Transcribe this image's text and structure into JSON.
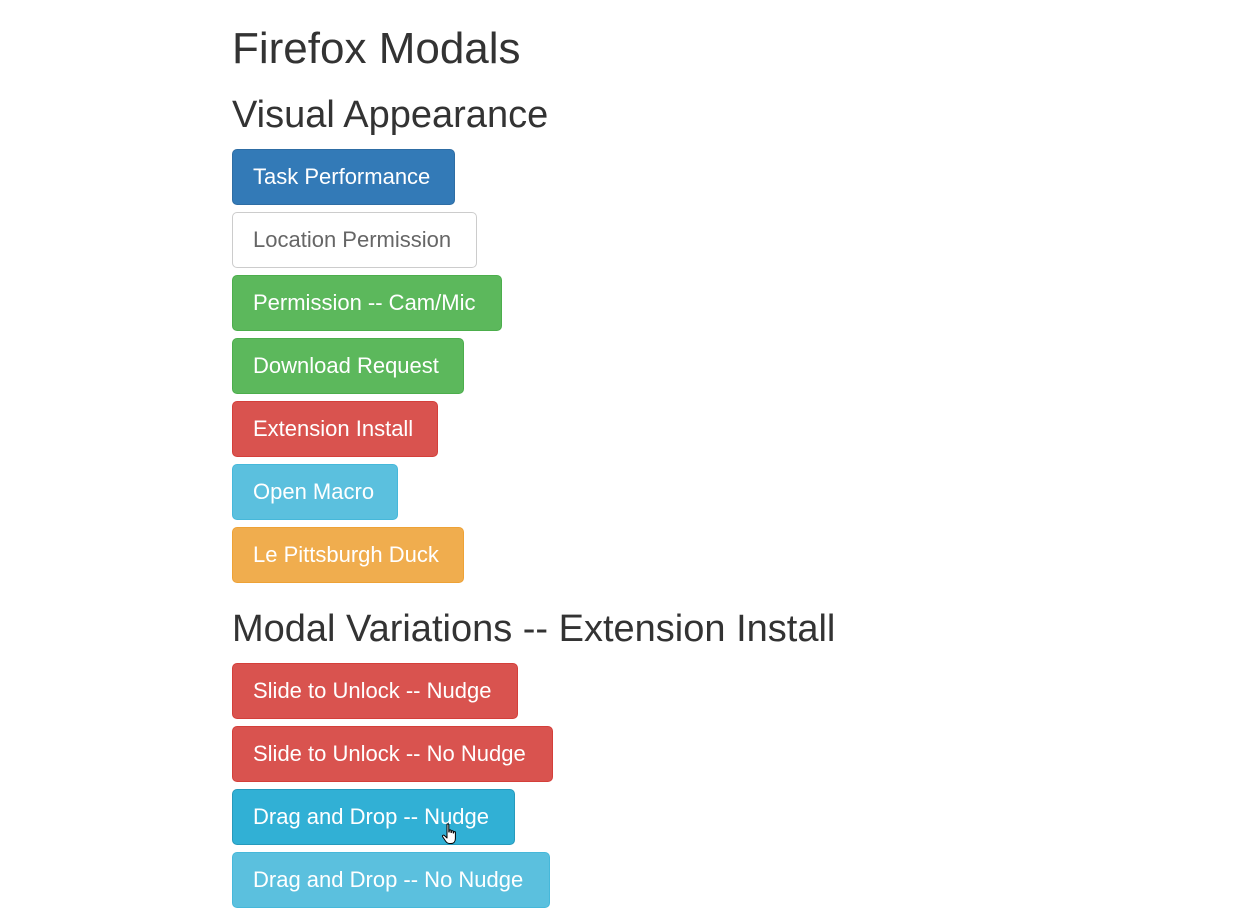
{
  "page": {
    "title": "Firefox Modals"
  },
  "sections": {
    "visual": {
      "heading": "Visual Appearance",
      "buttons": {
        "task_performance": "Task Performance",
        "location_permission": "Location Permission",
        "permission_cam_mic": "Permission -- Cam/Mic",
        "download_request": "Download Request",
        "extension_install": "Extension Install",
        "open_macro": "Open Macro",
        "pittsburgh_duck": "Le Pittsburgh Duck"
      }
    },
    "variations": {
      "heading": "Modal Variations -- Extension Install",
      "buttons": {
        "slide_nudge": "Slide to Unlock -- Nudge",
        "slide_no_nudge": "Slide to Unlock -- No Nudge",
        "drag_nudge": "Drag and Drop -- Nudge",
        "drag_no_nudge": "Drag and Drop -- No Nudge"
      }
    }
  },
  "colors": {
    "primary": "#337ab7",
    "default": "#ffffff",
    "success": "#5cb85c",
    "danger": "#d9534f",
    "info": "#5bc0de",
    "info_hover": "#31b0d5",
    "warning": "#f0ad4e"
  },
  "cursor": {
    "icon": "hand-pointer-icon"
  }
}
